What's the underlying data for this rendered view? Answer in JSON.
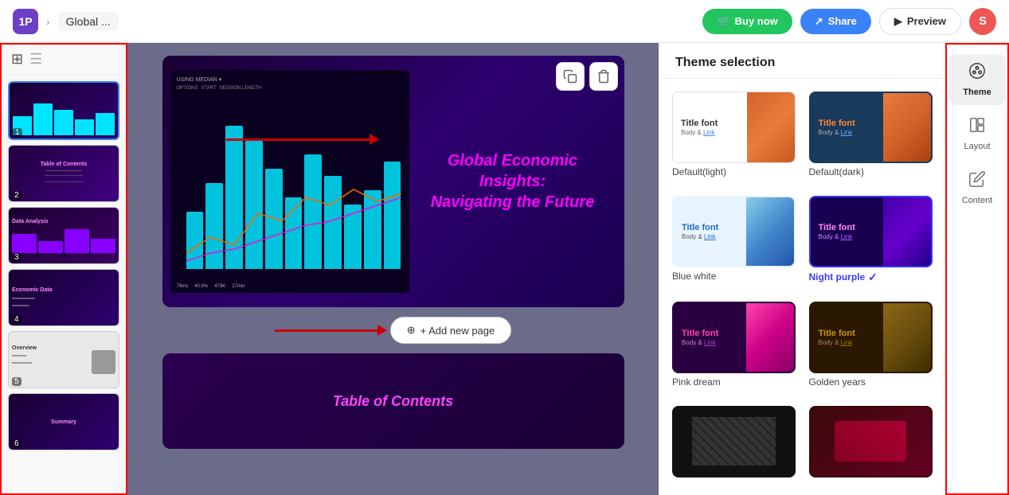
{
  "topbar": {
    "logo_text": "1P",
    "chevron": "›",
    "title": "Global ...",
    "buy_now_label": "Buy now",
    "share_label": "Share",
    "preview_label": "Preview",
    "avatar_letter": "S"
  },
  "slide_panel": {
    "view_grid_icon": "⊞",
    "view_list_icon": "≡",
    "slides": [
      {
        "number": "1",
        "theme": "thumb-1"
      },
      {
        "number": "2",
        "theme": "thumb-2"
      },
      {
        "number": "3",
        "theme": "thumb-3"
      },
      {
        "number": "4",
        "theme": "thumb-4"
      },
      {
        "number": "5",
        "theme": "thumb-5"
      },
      {
        "number": "6",
        "theme": "thumb-6"
      }
    ]
  },
  "canvas": {
    "main_slide_title_line1": "Global Economic Insights:",
    "main_slide_title_line2": "Navigating the Future",
    "second_slide_title": "Table of Contents",
    "add_page_label": "+ Add new page"
  },
  "theme_panel": {
    "title": "Theme selection",
    "themes": [
      {
        "id": "default-light",
        "label": "Default(light)",
        "selected": false
      },
      {
        "id": "default-dark",
        "label": "Default(dark)",
        "selected": false
      },
      {
        "id": "blue-white",
        "label": "Blue white",
        "selected": false
      },
      {
        "id": "night-purple",
        "label": "Night purple",
        "selected": true
      },
      {
        "id": "pink-dream",
        "label": "Pink dream",
        "selected": false
      },
      {
        "id": "golden-years",
        "label": "Golden years",
        "selected": false
      }
    ]
  },
  "right_sidebar": {
    "items": [
      {
        "id": "theme",
        "label": "Theme",
        "icon": "🎨",
        "active": true
      },
      {
        "id": "layout",
        "label": "Layout",
        "icon": "⬜",
        "active": false
      },
      {
        "id": "content",
        "label": "Content",
        "icon": "✏️",
        "active": false
      }
    ]
  }
}
